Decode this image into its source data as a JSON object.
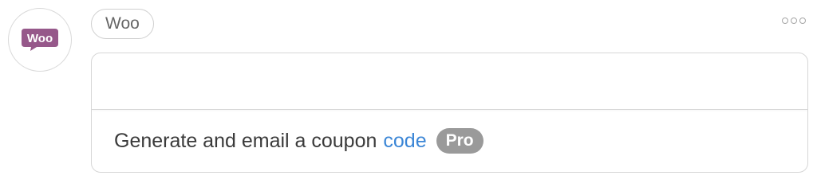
{
  "app": {
    "name": "Woo",
    "logo_text": "Woo",
    "brand_color": "#96588A"
  },
  "menu": {
    "icon": "more-horizontal-icon"
  },
  "action": {
    "text": "Generate and email a coupon",
    "link_word": "code",
    "badge": "Pro",
    "link_color": "#3B86D6",
    "badge_color": "#9A9A9A"
  }
}
